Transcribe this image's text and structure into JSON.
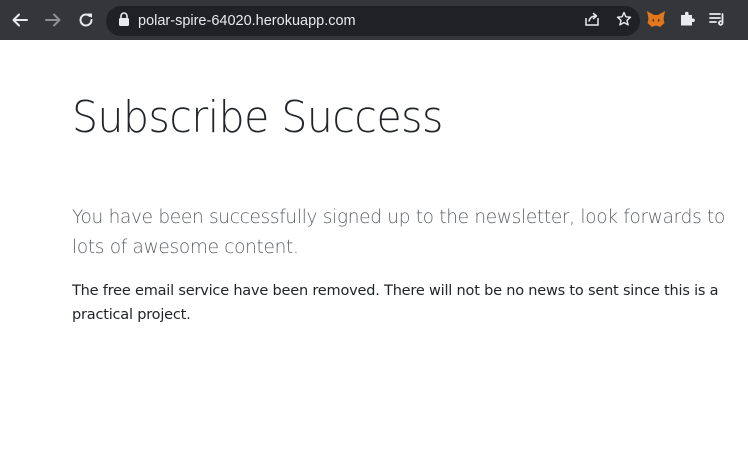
{
  "browser": {
    "url": "polar-spire-64020.herokuapp.com",
    "icons": {
      "back": "arrow-left-icon",
      "forward": "arrow-right-icon",
      "reload": "reload-icon",
      "secure": "lock-icon",
      "share": "share-icon",
      "bookmark": "star-icon",
      "extension_fox": "metamask-fox-icon",
      "extensions": "puzzle-icon",
      "reading_list": "reading-list-icon"
    },
    "colors": {
      "toolbar": "#35363a",
      "omnibox": "#202124",
      "text": "#e8eaed"
    }
  },
  "page": {
    "title": "Subscribe Success",
    "lead": "You have been successfully signed up to the newsletter, look forwards to lots of awesome content.",
    "note": "The free email service have been removed. There will not be no news to sent since this is a practical project."
  }
}
